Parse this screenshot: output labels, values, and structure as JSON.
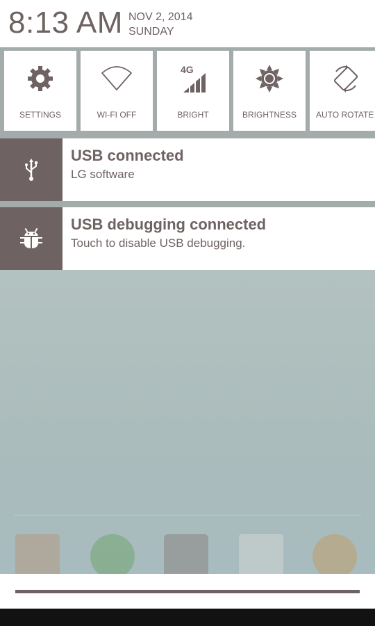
{
  "header": {
    "time": "8:13 AM",
    "date": "NOV 2, 2014",
    "day": "SUNDAY"
  },
  "quick_settings": [
    {
      "label": "SETTINGS",
      "icon": "gear-icon"
    },
    {
      "label": "WI-FI OFF",
      "icon": "wifi-icon"
    },
    {
      "label": "BRIGHT",
      "icon": "signal-4g-icon"
    },
    {
      "label": "BRIGHTNESS",
      "icon": "brightness-icon"
    },
    {
      "label": "AUTO ROTATE",
      "icon": "rotate-icon"
    }
  ],
  "notifications": [
    {
      "title": "USB connected",
      "text": "LG software",
      "icon": "usb-icon"
    },
    {
      "title": "USB debugging connected",
      "text": "Touch to disable USB debugging.",
      "icon": "bug-icon"
    }
  ],
  "indicators": {
    "signal": "4G"
  },
  "colors": {
    "accent": "#6f6262",
    "tile_bg": "#ffffff",
    "frame": "#a3acab"
  }
}
